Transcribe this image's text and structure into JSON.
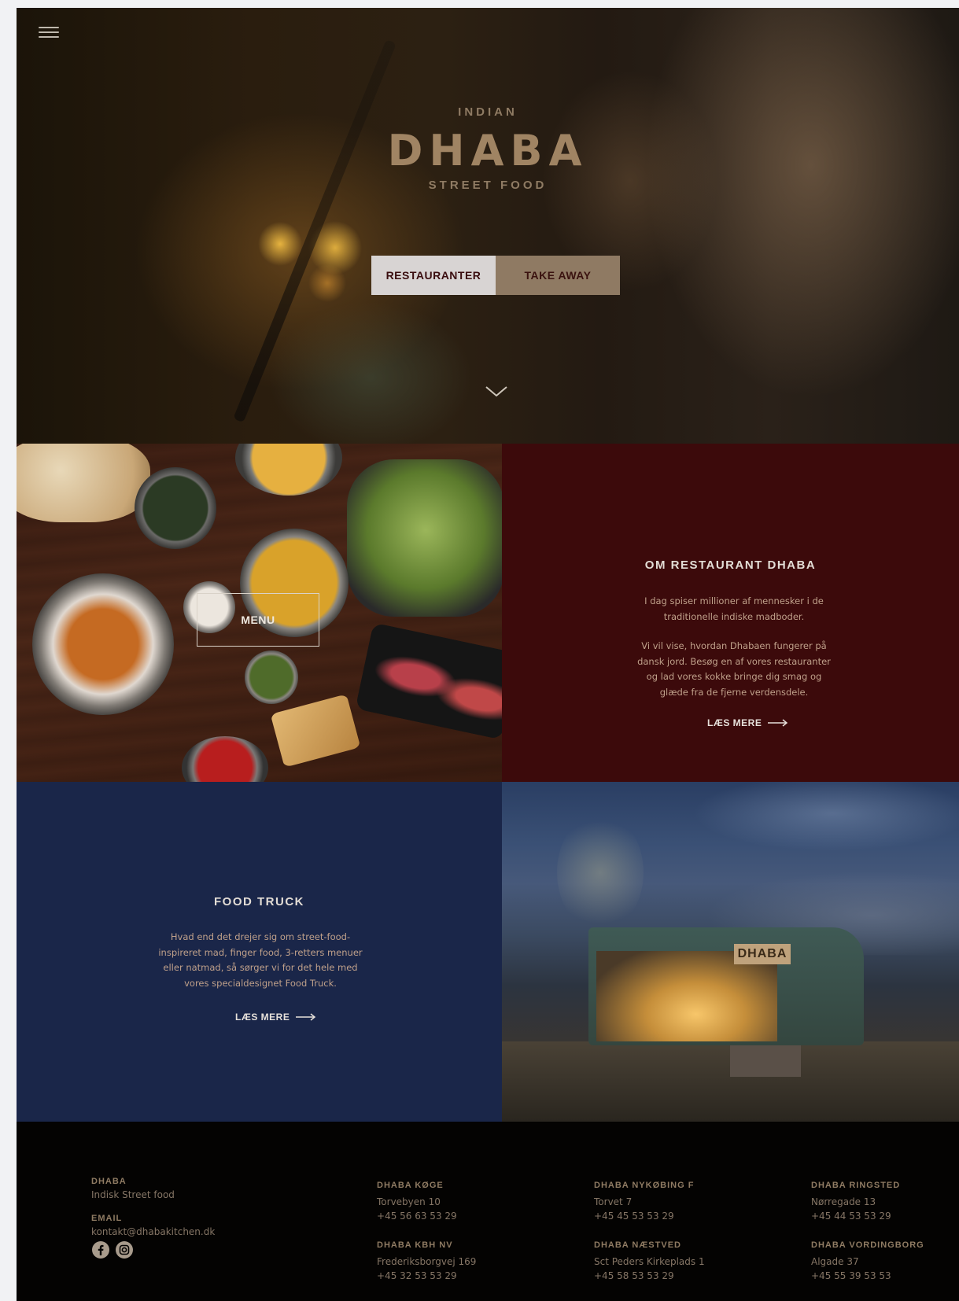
{
  "hero": {
    "logo_top": "INDIAN",
    "logo_main": "DHABA",
    "logo_bottom": "STREET FOOD",
    "buttons": [
      {
        "label": "RESTAURANTER"
      },
      {
        "label": "TAKE AWAY"
      }
    ]
  },
  "menu_tile": {
    "label": "MENU"
  },
  "about": {
    "title": "OM RESTAURANT DHABA",
    "paragraphs": [
      "I dag spiser millioner af mennesker i de traditionelle indiske madboder.",
      "Vi vil vise, hvordan Dhabaen fungerer på dansk jord. Besøg en af vores restauranter og lad vores kokke bringe dig smag og glæde fra de fjerne verdensdele."
    ],
    "read_more": "LÆS MERE"
  },
  "food_truck": {
    "title": "FOOD TRUCK",
    "paragraph": "Hvad end det drejer sig om street-food-inspireret mad, finger food, 3-retters menuer eller natmad, så sørger vi for det hele med vores specialdesignet Food Truck.",
    "read_more": "LÆS MERE",
    "truck_sign": "DHABA"
  },
  "footer": {
    "brand": {
      "name": "DHABA",
      "tagline": "Indisk Street food"
    },
    "email": {
      "label": "EMAIL",
      "value": "kontakt@dhabakitchen.dk"
    },
    "locations": [
      {
        "name": "DHABA KØGE",
        "address": "Torvebyen 10",
        "phone": "+45 56 63 53 29"
      },
      {
        "name": "DHABA KBH NV",
        "address": "Frederiksborgvej 169",
        "phone": "+45 32 53 53 29"
      },
      {
        "name": "DHABA NYKØBING F",
        "address": "Torvet 7",
        "phone": "+45 45 53 53 29"
      },
      {
        "name": "DHABA NÆSTVED",
        "address": "Sct Peders Kirkeplads 1",
        "phone": "+45 58 53 53 29"
      },
      {
        "name": "DHABA RINGSTED",
        "address": "Nørregade 13",
        "phone": "+45 44 53 53 29"
      },
      {
        "name": "DHABA VORDINGBORG",
        "address": "Algade 37",
        "phone": "+45 55 39 53 53"
      }
    ],
    "social": [
      "facebook-icon",
      "instagram-icon"
    ]
  },
  "colors": {
    "accent_gold": "#8f7b63",
    "about_bg": "#3c0a0b",
    "truck_bg": "#1a2649",
    "footer_bg": "#040302"
  }
}
